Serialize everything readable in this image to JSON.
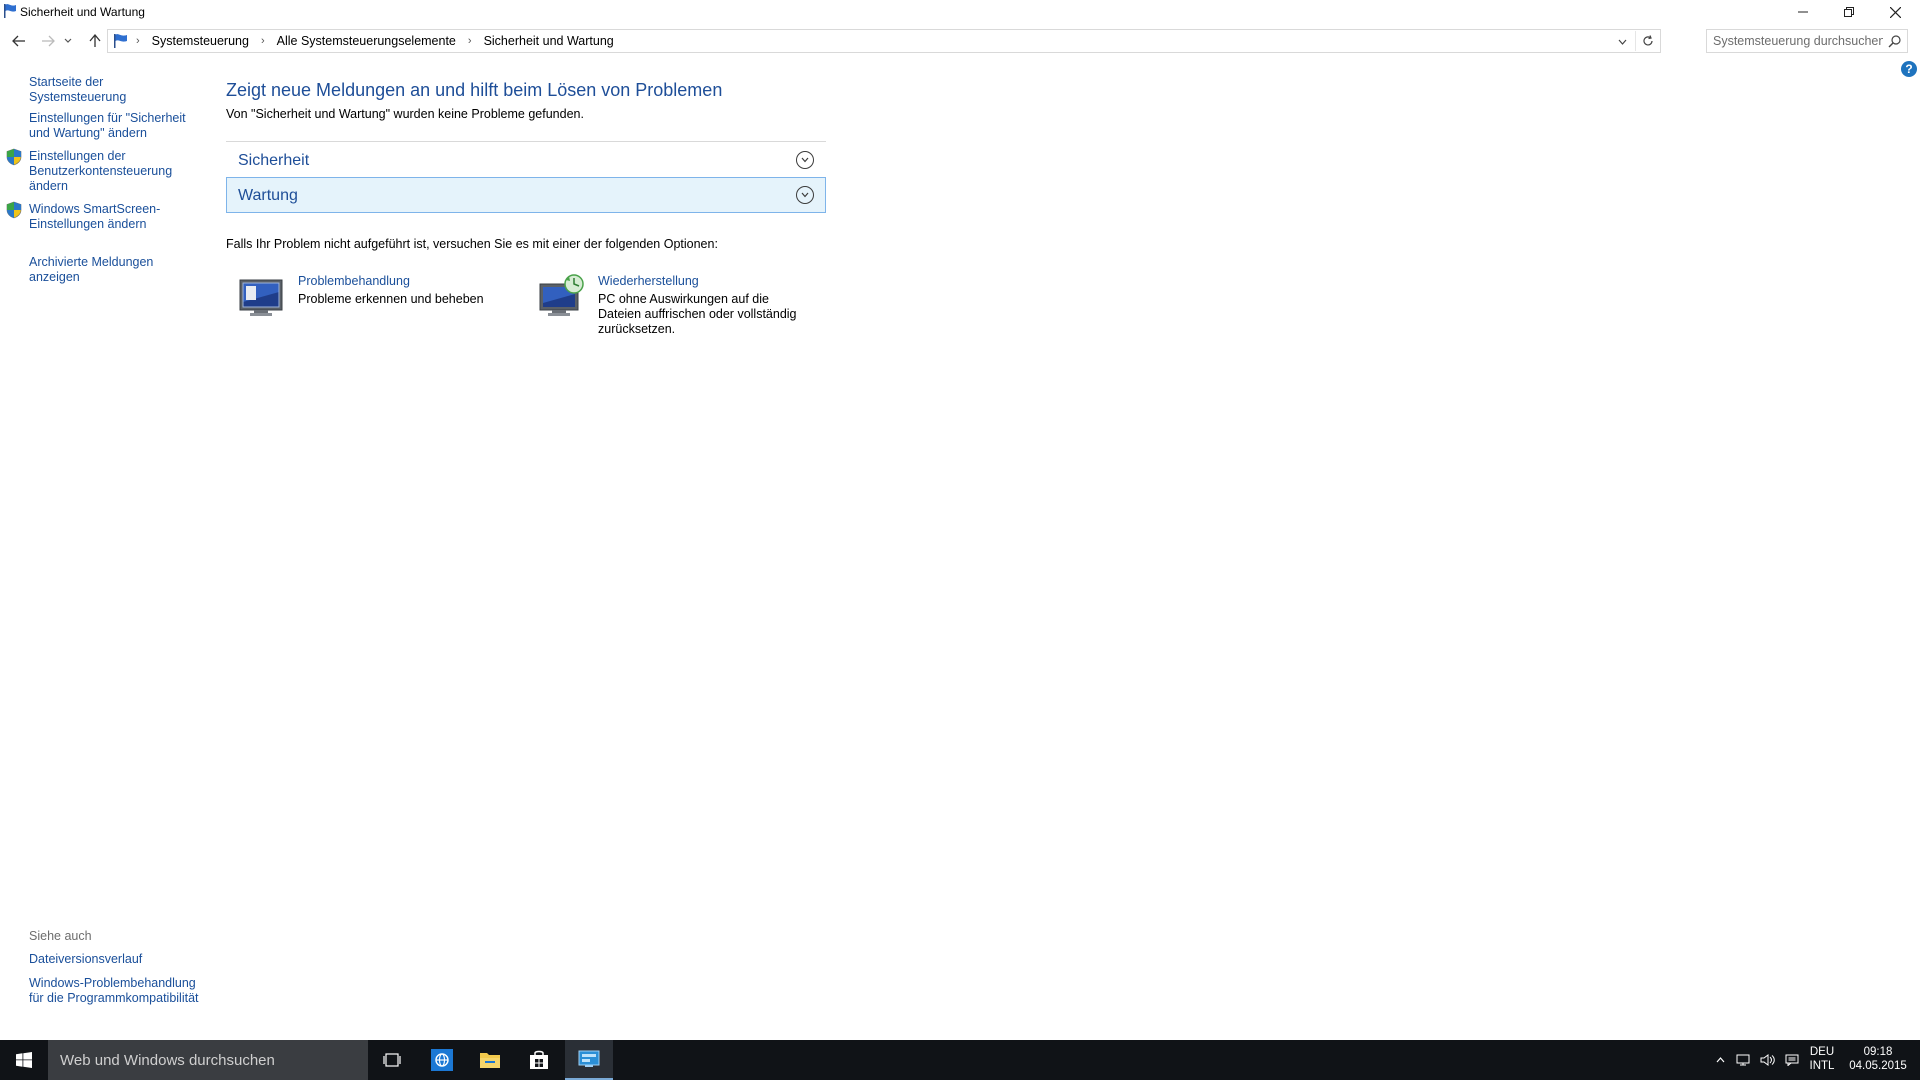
{
  "window": {
    "title": "Sicherheit und Wartung"
  },
  "nav": {
    "breadcrumbs": [
      "Systemsteuerung",
      "Alle Systemsteuerungselemente",
      "Sicherheit und Wartung"
    ],
    "search_placeholder": "Systemsteuerung durchsuchen"
  },
  "left_pane": {
    "links": [
      {
        "label": "Startseite der Systemsteuerung",
        "shield": false
      },
      {
        "label": "Einstellungen für \"Sicherheit und Wartung\" ändern",
        "shield": false
      },
      {
        "label": "Einstellungen der Benutzerkontensteuerung ändern",
        "shield": true
      },
      {
        "label": "Windows SmartScreen-Einstellungen ändern",
        "shield": true
      },
      {
        "label": "Archivierte Meldungen anzeigen",
        "shield": false
      }
    ],
    "see_also_title": "Siehe auch",
    "see_also": [
      {
        "label": "Dateiversionsverlauf"
      },
      {
        "label": "Windows-Problembehandlung für die Programmkompatibilität"
      }
    ]
  },
  "main": {
    "heading": "Zeigt neue Meldungen an und hilft beim Lösen von Problemen",
    "subline": "Von \"Sicherheit und Wartung\" wurden keine Probleme gefunden.",
    "sections": [
      {
        "label": "Sicherheit",
        "selected": false
      },
      {
        "label": "Wartung",
        "selected": true
      }
    ],
    "options_intro": "Falls Ihr Problem nicht aufgeführt ist, versuchen Sie es mit einer der folgenden Optionen:",
    "options": [
      {
        "title": "Problembehandlung",
        "description": "Probleme erkennen und beheben",
        "icon": "troubleshooting-icon"
      },
      {
        "title": "Wiederherstellung",
        "description": "PC ohne Auswirkungen auf die Dateien auffrischen oder vollständig zurücksetzen.",
        "icon": "recovery-icon"
      }
    ]
  },
  "taskbar": {
    "search_placeholder": "Web und Windows durchsuchen",
    "apps": [
      "task-view-icon",
      "edge-browser-icon",
      "file-explorer-icon",
      "store-icon",
      "control-panel-icon"
    ],
    "language": {
      "line1": "DEU",
      "line2": "INTL"
    },
    "clock": {
      "time": "09:18",
      "date": "04.05.2015"
    }
  },
  "colors": {
    "link": "#1a4f9a",
    "heading": "#1e4e98",
    "selected_section_bg": "#e5f3fb",
    "selected_section_border": "#7eb4ea",
    "taskbar_bg": "#101317"
  }
}
